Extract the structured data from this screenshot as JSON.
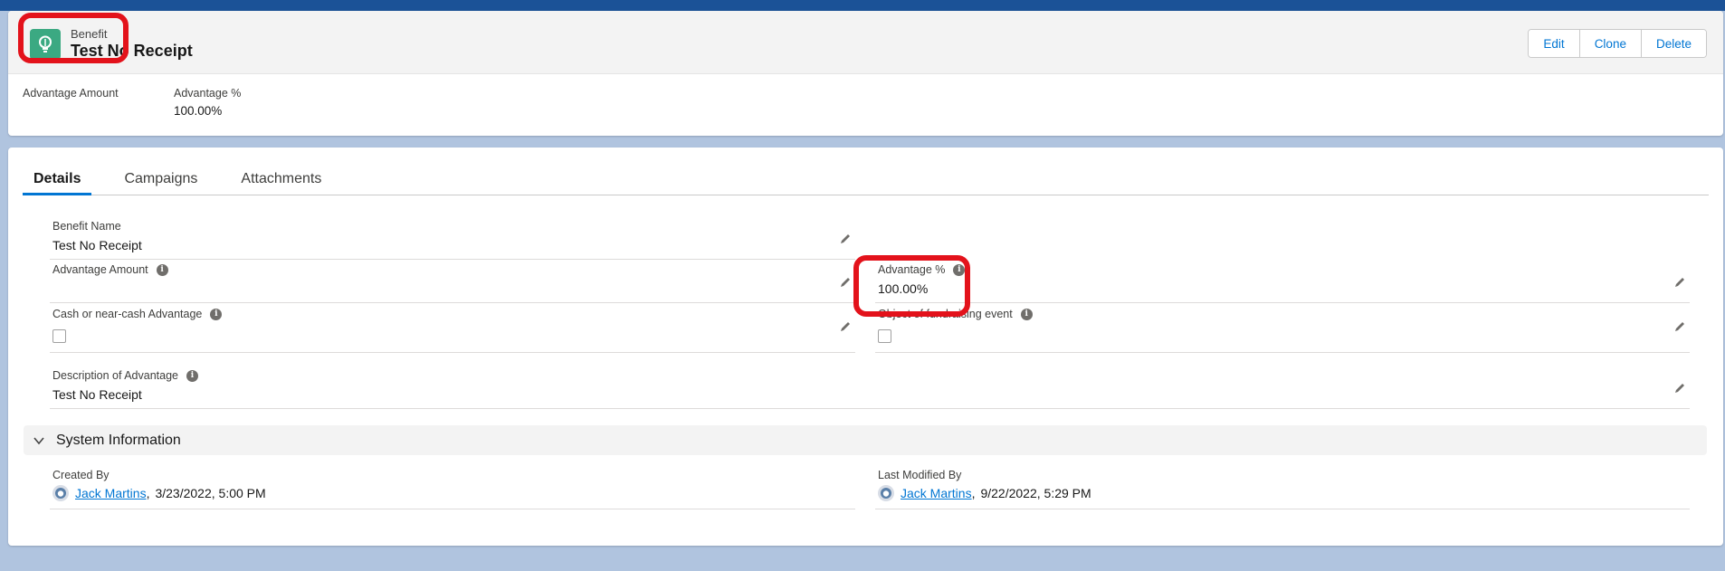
{
  "header": {
    "object_type": "Benefit",
    "record_name": "Test No Receipt",
    "icon": "lightbulb-icon",
    "buttons": {
      "edit": "Edit",
      "clone": "Clone",
      "delete": "Delete"
    },
    "highlights": [
      {
        "label": "Advantage Amount",
        "value": ""
      },
      {
        "label": "Advantage %",
        "value": "100.00%"
      }
    ]
  },
  "tabs": [
    "Details",
    "Campaigns",
    "Attachments"
  ],
  "details": {
    "benefit_name": {
      "label": "Benefit Name",
      "value": "Test No Receipt"
    },
    "advantage_amount": {
      "label": "Advantage Amount",
      "value": ""
    },
    "advantage_pct": {
      "label": "Advantage %",
      "value": "100.00%"
    },
    "cash_advantage": {
      "label": "Cash or near-cash Advantage",
      "checked": false
    },
    "fundraising_event": {
      "label": "Object of fundraising event",
      "checked": false
    },
    "description": {
      "label": "Description of Advantage",
      "value": "Test No Receipt"
    }
  },
  "system_info": {
    "title": "System Information",
    "created_by": {
      "label": "Created By",
      "user": "Jack Martins",
      "date": "3/23/2022, 5:00 PM"
    },
    "last_modified_by": {
      "label": "Last Modified By",
      "user": "Jack Martins",
      "date": "9/22/2022, 5:29 PM"
    }
  },
  "colors": {
    "brand_blue": "#0176d3",
    "icon_green": "#3ba982",
    "annotation_red": "#e3121b"
  }
}
